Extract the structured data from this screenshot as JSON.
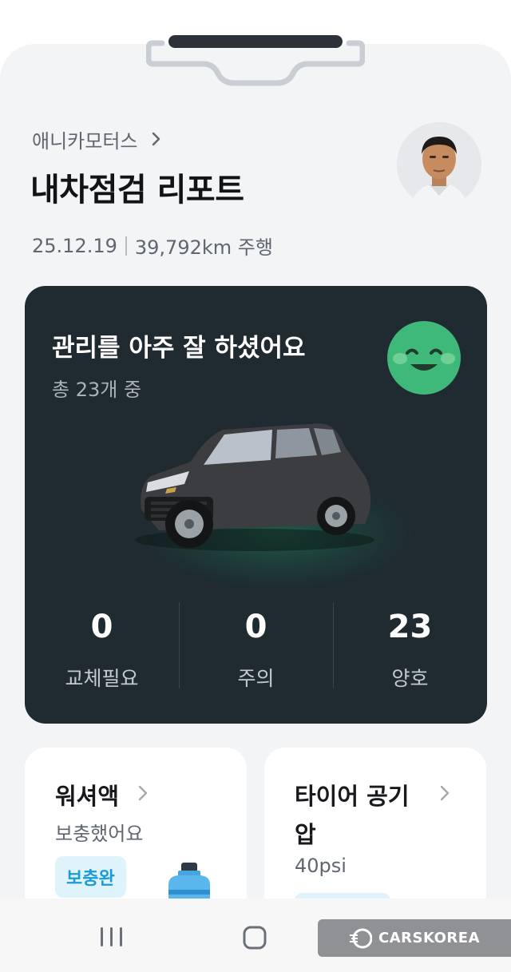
{
  "header": {
    "brand": "애니카모터스",
    "title": "내차점검 리포트",
    "date": "25.12.19",
    "mileage": "39,792km 주행"
  },
  "report": {
    "headline": "관리를 아주 잘 하셨어요",
    "subtitle": "총 23개 중",
    "status_color": "#3fb97a",
    "stats": [
      {
        "value": "0",
        "label": "교체필요"
      },
      {
        "value": "0",
        "label": "주의"
      },
      {
        "value": "23",
        "label": "양호"
      }
    ]
  },
  "tiles": [
    {
      "title": "워셔액",
      "status": "보충했어요",
      "badge": "보충완"
    },
    {
      "title": "타이어 공기압",
      "value": "40psi"
    }
  ],
  "colors": {
    "accent": "#1a9bd7",
    "card_dark": "#1f2a31"
  },
  "watermark": "CARSKOREA",
  "icons": [
    "chevron-right-icon",
    "smiley-icon",
    "bottle-icon",
    "recent-apps-icon",
    "home-icon"
  ]
}
